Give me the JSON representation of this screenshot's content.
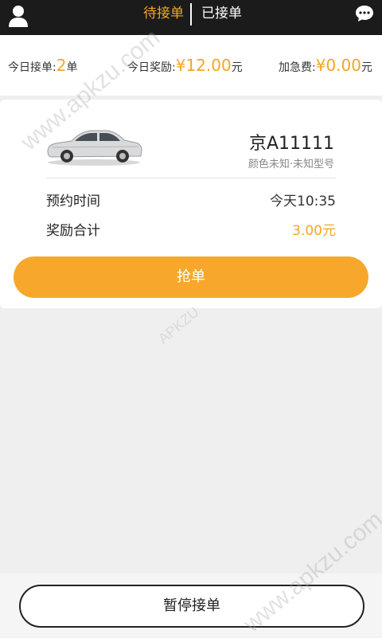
{
  "header": {
    "tabs": [
      {
        "label": "待接单",
        "active": true
      },
      {
        "label": "已接单",
        "active": false
      }
    ],
    "icons": {
      "user": "user-icon",
      "messages": "chat-bubble-icon"
    }
  },
  "stats": {
    "orders_label": "今日接单:",
    "orders_value": "2",
    "orders_unit": "单",
    "reward_label": "今日奖励:",
    "reward_value": "¥12.00",
    "reward_unit": "元",
    "fee_label": "加急费:",
    "fee_value": "¥0.00",
    "fee_unit": "元"
  },
  "order": {
    "plate": "京A11111",
    "car_desc": "颜色未知·未知型号",
    "time_label": "预约时间",
    "time_value": "今天10:35",
    "reward_label": "奖励合计",
    "reward_value": "3.00元",
    "grab_label": "抢单"
  },
  "footer": {
    "pause_label": "暂停接单"
  },
  "watermark": {
    "text": "www.apkzu.com",
    "small_text": "APKZU"
  },
  "colors": {
    "accent": "#f5a623",
    "topbar": "#1b1b1b",
    "background": "#efefef"
  }
}
